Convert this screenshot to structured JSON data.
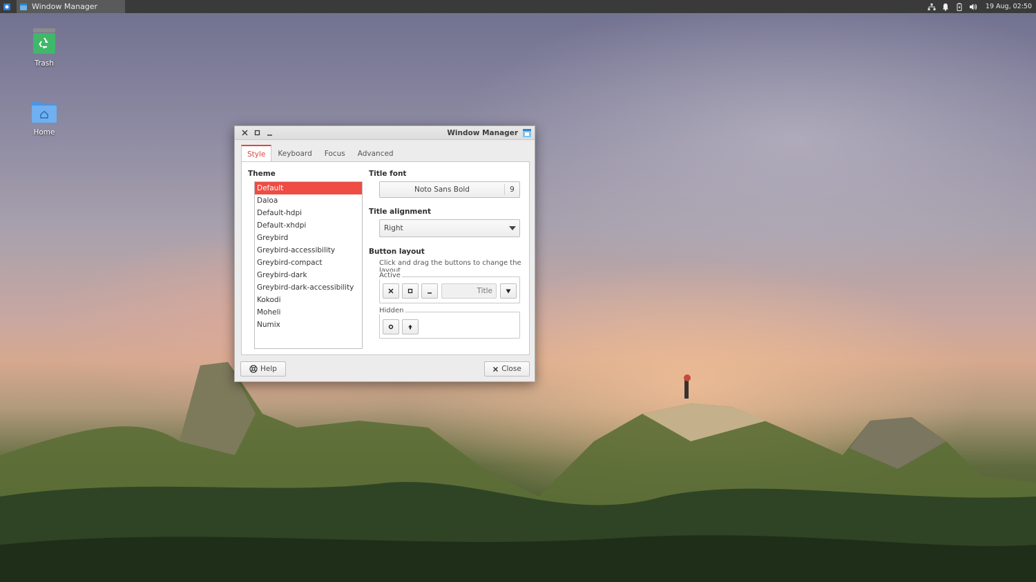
{
  "panel": {
    "task_title": "Window Manager",
    "clock": "19 Aug, 02:50",
    "tray_icons": [
      "network-icon",
      "notification-bell-icon",
      "battery-icon",
      "volume-icon"
    ]
  },
  "desktop": {
    "icons": [
      {
        "label": "Trash",
        "icon": "trash-icon"
      },
      {
        "label": "Home",
        "icon": "home-folder-icon"
      }
    ]
  },
  "window": {
    "title": "Window Manager",
    "tabs": [
      {
        "label": "Style",
        "active": true
      },
      {
        "label": "Keyboard",
        "active": false
      },
      {
        "label": "Focus",
        "active": false
      },
      {
        "label": "Advanced",
        "active": false
      }
    ],
    "theme": {
      "label": "Theme",
      "items": [
        "Default",
        "Daloa",
        "Default-hdpi",
        "Default-xhdpi",
        "Greybird",
        "Greybird-accessibility",
        "Greybird-compact",
        "Greybird-dark",
        "Greybird-dark-accessibility",
        "Kokodi",
        "Moheli",
        "Numix"
      ],
      "selected": "Default"
    },
    "title_font": {
      "label": "Title font",
      "name": "Noto Sans Bold",
      "size": "9"
    },
    "title_alignment": {
      "label": "Title alignment",
      "value": "Right"
    },
    "button_layout": {
      "label": "Button layout",
      "hint": "Click and drag the buttons to change the layout",
      "active_label": "Active",
      "title_placeholder": "Title",
      "hidden_label": "Hidden"
    },
    "help_label": "Help",
    "close_label": "Close"
  }
}
